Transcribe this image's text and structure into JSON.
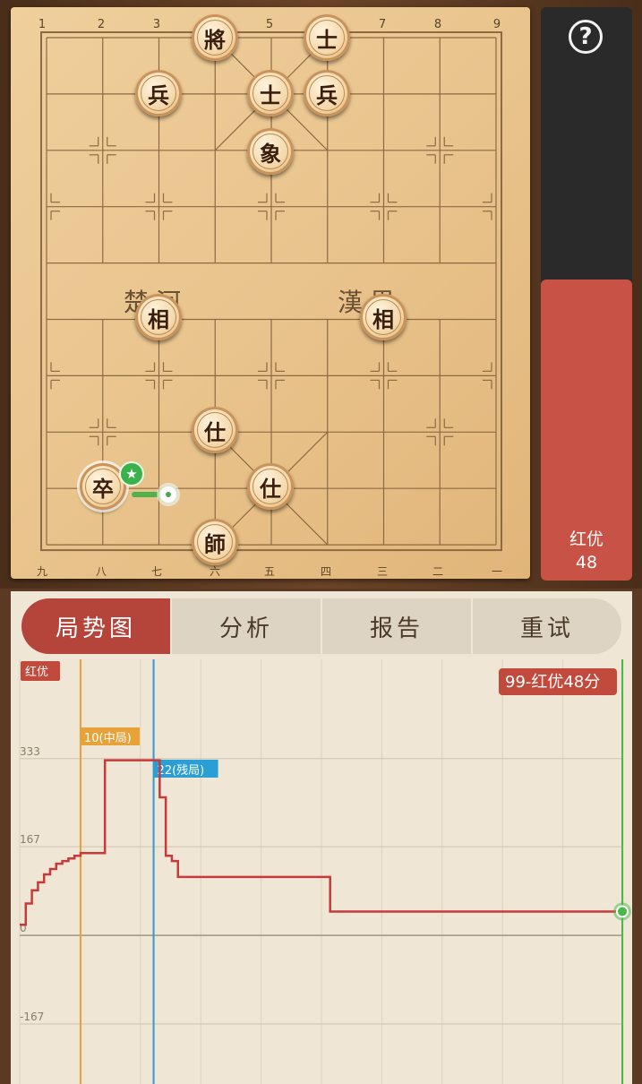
{
  "board": {
    "top_files": [
      "1",
      "2",
      "3",
      "4",
      "5",
      "6",
      "7",
      "8",
      "9"
    ],
    "bottom_files": [
      "九",
      "八",
      "七",
      "六",
      "五",
      "四",
      "三",
      "二",
      "一"
    ],
    "river_left": "楚河",
    "river_right": "漢界",
    "pieces": {
      "black_general": "將",
      "black_advisor_1": "士",
      "black_advisor_2": "士",
      "black_soldier_1": "兵",
      "black_soldier_2": "兵",
      "black_elephant": "象",
      "red_minister_1": "相",
      "red_minister_2": "相",
      "red_advisor_1": "仕",
      "red_advisor_2": "仕",
      "red_king": "師",
      "selected_piece": "卒"
    }
  },
  "eval_bar": {
    "help": "?",
    "label_line1": "红优",
    "label_line2": "48",
    "red_share": 0.525
  },
  "tabs": [
    "局势图",
    "分析",
    "报告",
    "重试"
  ],
  "active_tab": 0,
  "chart_data": {
    "type": "line",
    "x": [
      0,
      1,
      2,
      3,
      4,
      5,
      6,
      7,
      8,
      9,
      10,
      11,
      12,
      13,
      14,
      15,
      16,
      17,
      18,
      19,
      20,
      21,
      22,
      23,
      24,
      25,
      26,
      27,
      28,
      29,
      30,
      40,
      50,
      51,
      60,
      70,
      80,
      90,
      99
    ],
    "y": [
      20,
      60,
      85,
      100,
      115,
      125,
      135,
      140,
      145,
      150,
      155,
      155,
      155,
      155,
      330,
      330,
      330,
      330,
      330,
      330,
      330,
      330,
      330,
      260,
      150,
      140,
      110,
      110,
      110,
      110,
      110,
      110,
      110,
      45,
      45,
      45,
      45,
      45,
      45
    ],
    "ylim": [
      -280,
      520
    ],
    "yticks": [
      333,
      167,
      0,
      -167
    ],
    "tick_labels": [
      "333",
      "167",
      "0",
      "-167"
    ],
    "series_color": "#c73a3a",
    "corner_label": "红优",
    "score_badge": "99-红优48分",
    "markers": [
      {
        "x": 10,
        "label": "10(中局)",
        "color": "#e8a23a"
      },
      {
        "x": 22,
        "label": "22(残局)",
        "color": "#2a9fd6"
      }
    ],
    "current_x": 99,
    "current_color": "#4ab84a"
  }
}
